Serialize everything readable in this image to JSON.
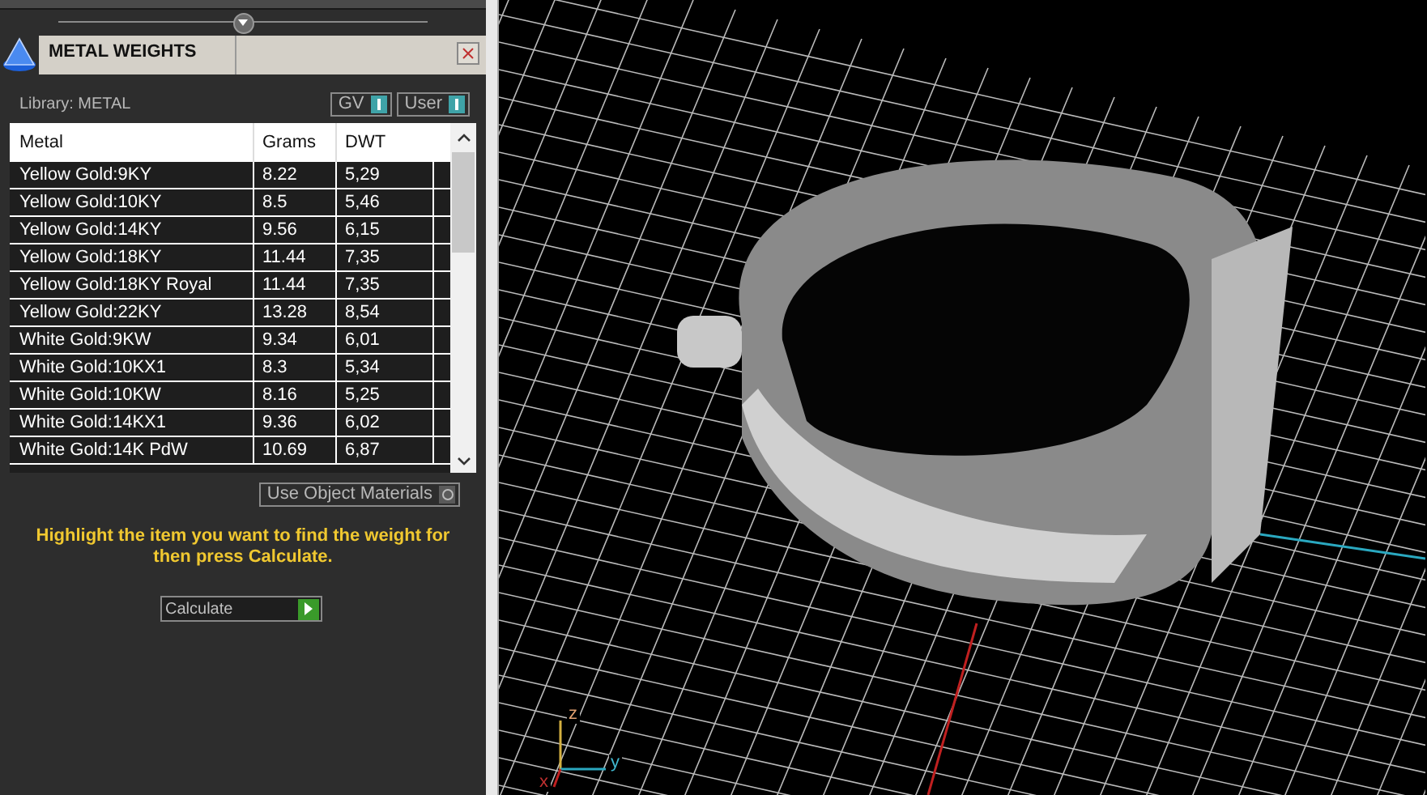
{
  "panel": {
    "title": "METAL WEIGHTS",
    "library_label": "Library: METAL",
    "toggles": [
      {
        "label": "GV",
        "on": true
      },
      {
        "label": "User",
        "on": true
      }
    ]
  },
  "table": {
    "columns": [
      "Metal",
      "Grams",
      "DWT"
    ],
    "rows": [
      {
        "metal": "Yellow Gold:9KY",
        "grams": "8.22",
        "dwt": "5,29"
      },
      {
        "metal": "Yellow Gold:10KY",
        "grams": "8.5",
        "dwt": "5,46"
      },
      {
        "metal": "Yellow Gold:14KY",
        "grams": "9.56",
        "dwt": "6,15"
      },
      {
        "metal": "Yellow Gold:18KY",
        "grams": "11.44",
        "dwt": "7,35"
      },
      {
        "metal": "Yellow Gold:18KY Royal",
        "grams": "11.44",
        "dwt": "7,35"
      },
      {
        "metal": "Yellow Gold:22KY",
        "grams": "13.28",
        "dwt": "8,54"
      },
      {
        "metal": "White Gold:9KW",
        "grams": "9.34",
        "dwt": "6,01"
      },
      {
        "metal": "White Gold:10KX1",
        "grams": "8.3",
        "dwt": "5,34"
      },
      {
        "metal": "White Gold:10KW",
        "grams": "8.16",
        "dwt": "5,25"
      },
      {
        "metal": "White Gold:14KX1",
        "grams": "9.36",
        "dwt": "6,02"
      },
      {
        "metal": "White Gold:14K PdW",
        "grams": "10.69",
        "dwt": "6,87"
      }
    ]
  },
  "use_object_materials": {
    "label": "Use Object Materials",
    "on": false
  },
  "hint": "Highlight the item you want to find the weight for then press Calculate.",
  "calculate_button": "Calculate",
  "viewport": {
    "axes": [
      {
        "label": "z"
      },
      {
        "label": "y"
      },
      {
        "label": "x"
      }
    ]
  }
}
